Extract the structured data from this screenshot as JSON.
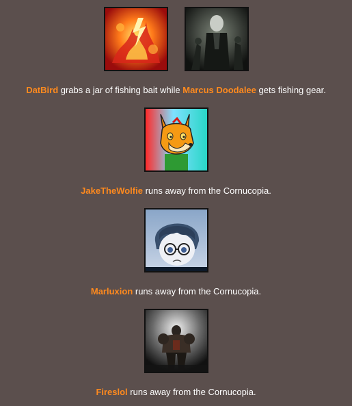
{
  "events": [
    {
      "avatars": [
        {
          "name": "DatBird",
          "icon": "fire-dragon-avatar-icon"
        },
        {
          "name": "Marcus Doodalee",
          "icon": "dark-figure-avatar-icon"
        }
      ],
      "tribute1": "DatBird",
      "mid1": " grabs a jar of fishing bait while ",
      "tribute2": "Marcus Doodalee",
      "mid2": " gets fishing gear."
    },
    {
      "avatars": [
        {
          "name": "JakeTheWolfie",
          "icon": "fox-avatar-icon"
        }
      ],
      "tribute1": "JakeTheWolfie",
      "mid1": " runs away from the Cornucopia."
    },
    {
      "avatars": [
        {
          "name": "Marluxion",
          "icon": "anime-boy-avatar-icon"
        }
      ],
      "tribute1": "Marluxion",
      "mid1": " runs away from the Cornucopia."
    },
    {
      "avatars": [
        {
          "name": "Fireslol",
          "icon": "armored-warrior-avatar-icon"
        }
      ],
      "tribute1": "Fireslol",
      "mid1": " runs away from the Cornucopia."
    }
  ],
  "colors": {
    "background": "#5b4f4d",
    "tribute_name": "#ff8a1e",
    "text": "#ffffff"
  }
}
